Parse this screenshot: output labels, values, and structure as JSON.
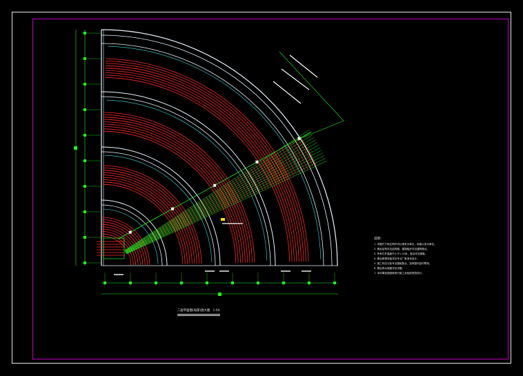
{
  "drawing": {
    "colors": {
      "background": "#000000",
      "frame": "#e6e6e6",
      "border": "#c000c0",
      "wall": "#e8f4ff",
      "stair": "#ff2a2a",
      "dimension": "#22ee22",
      "structure": "#40e0e0",
      "annotation": "#ffffff"
    },
    "rings": 4,
    "stair_bands": 4,
    "axis_dimension_marks": 10
  },
  "notes": {
    "title": "说明：",
    "lines": [
      "1. 本图尺寸除注明外均以毫米为单位，标高以米为单位。",
      "2. 看台结构详见结构图，楼梯踏步详见建筑做法。",
      "3. 所有栏杆高度不小于1.05米，做法详见图集。",
      "4. 看台座椅安装详见专业厂家深化设计。",
      "5. 施工时应与各专业图纸配合，如有疑问及时联系。",
      "6. 看台排水坡度详见详图。",
      "7. 未尽事宜按国家现行施工及验收规范执行。"
    ]
  },
  "title_block": {
    "title": "二层平面图(局部)放大图",
    "scale": "1:50"
  }
}
